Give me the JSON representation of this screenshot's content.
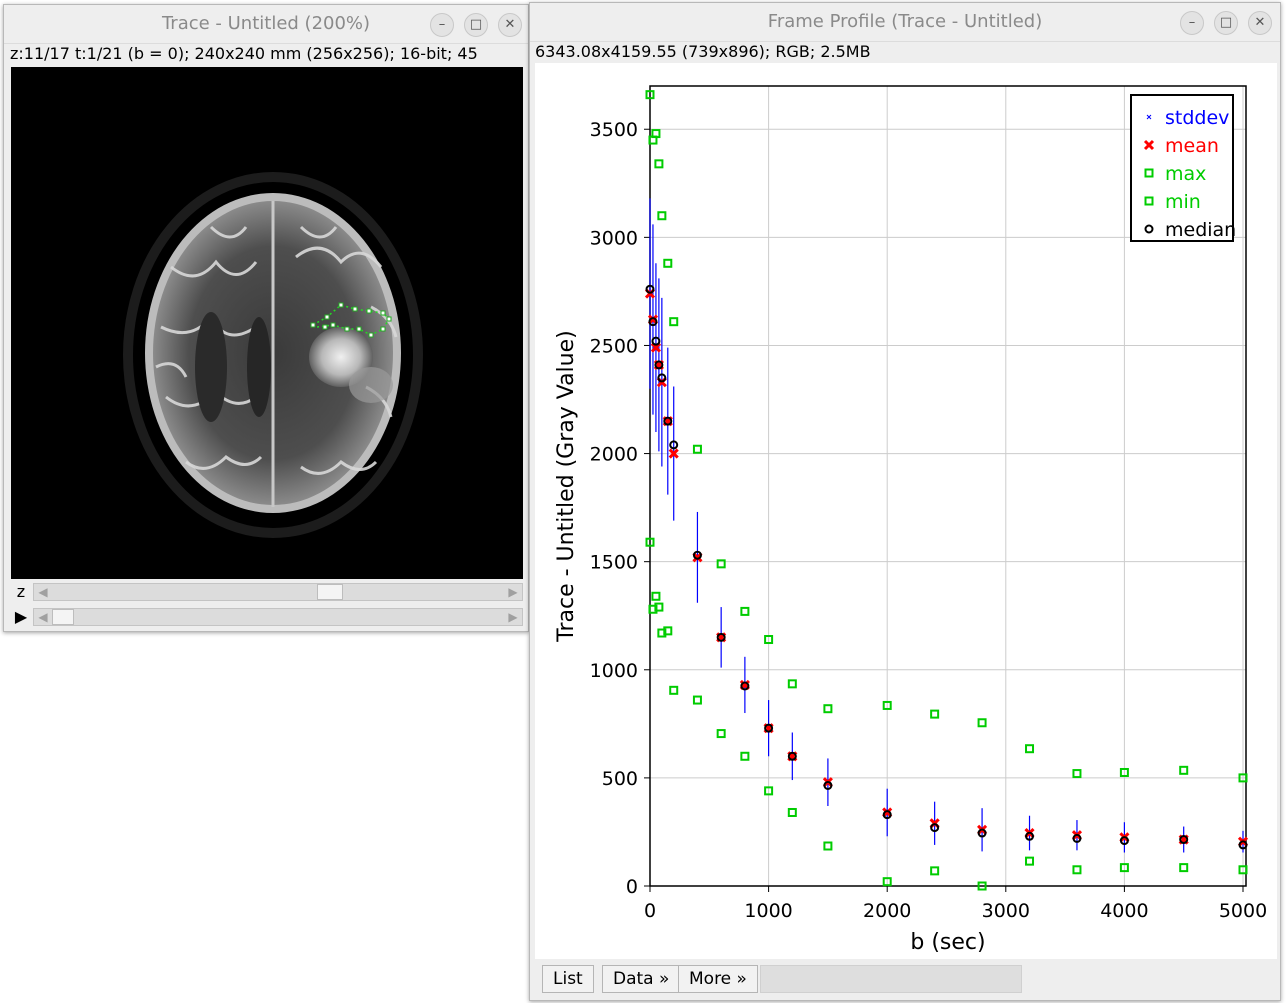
{
  "image_window": {
    "title": "Trace - Untitled (200%)",
    "info": "z:11/17 t:1/21 (b = 0); 240x240 mm (256x256); 16-bit; 45",
    "z_label": "z",
    "z_slider_fraction": 0.62,
    "t_slider_fraction": 0.0,
    "controls": {
      "minimize": "–",
      "maximize": "□",
      "close": "✕"
    },
    "play_icon": "play-icon"
  },
  "plot_window": {
    "title": "Frame Profile (Trace - Untitled)",
    "info": "6343.08x4159.55    (739x896); RGB; 2.5MB",
    "buttons": {
      "list": "List",
      "data": "Data »",
      "more": "More »"
    },
    "controls": {
      "minimize": "–",
      "maximize": "□",
      "close": "✕"
    }
  },
  "chart_data": {
    "type": "scatter",
    "xlabel": "b (sec)",
    "ylabel": "Trace - Untitled (Gray Value)",
    "xlim": [
      0,
      5000
    ],
    "ylim": [
      0,
      3700
    ],
    "xticks": [
      0,
      1000,
      2000,
      3000,
      4000,
      5000
    ],
    "yticks": [
      0,
      500,
      1000,
      1500,
      2000,
      2500,
      3000,
      3500
    ],
    "grid": true,
    "legend_position": "top-right",
    "x": [
      0,
      25,
      50,
      75,
      100,
      150,
      200,
      400,
      600,
      800,
      1000,
      1200,
      1500,
      2000,
      2400,
      2800,
      3200,
      3600,
      4000,
      4500,
      5000
    ],
    "series": [
      {
        "name": "stddev",
        "color": "#0000ff",
        "marker": "errorbar",
        "values": [
          440,
          440,
          390,
          400,
          390,
          340,
          310,
          210,
          140,
          130,
          130,
          110,
          110,
          110,
          100,
          100,
          80,
          70,
          70,
          60,
          50
        ]
      },
      {
        "name": "mean",
        "color": "#ff0000",
        "marker": "x",
        "values": [
          2740,
          2620,
          2490,
          2410,
          2330,
          2150,
          2000,
          1520,
          1150,
          930,
          730,
          600,
          480,
          340,
          290,
          260,
          245,
          235,
          225,
          215,
          205
        ]
      },
      {
        "name": "max",
        "color": "#00cc00",
        "marker": "square",
        "values": [
          3660,
          3450,
          3480,
          3340,
          3100,
          2880,
          2610,
          2020,
          1490,
          1270,
          1140,
          935,
          820,
          835,
          795,
          755,
          635,
          520,
          525,
          535,
          500
        ]
      },
      {
        "name": "min",
        "color": "#00cc00",
        "marker": "square",
        "values": [
          1590,
          1280,
          1340,
          1290,
          1170,
          1180,
          905,
          860,
          705,
          600,
          440,
          340,
          185,
          20,
          70,
          0,
          115,
          75,
          85,
          85,
          75
        ]
      },
      {
        "name": "median",
        "color": "#000000",
        "marker": "circle",
        "values": [
          2760,
          2610,
          2520,
          2410,
          2350,
          2150,
          2040,
          1530,
          1150,
          925,
          730,
          600,
          465,
          330,
          270,
          245,
          230,
          220,
          210,
          215,
          190
        ]
      }
    ]
  }
}
